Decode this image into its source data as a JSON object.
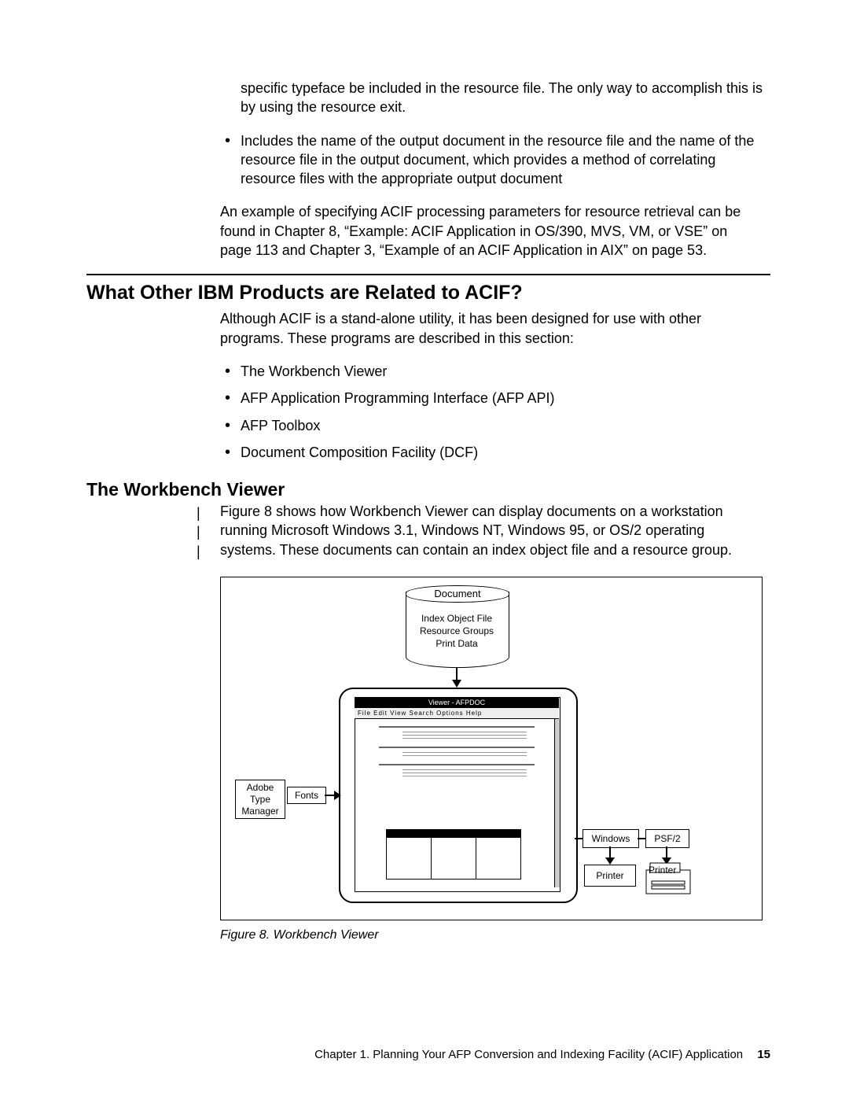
{
  "intro": {
    "p1": "specific typeface be included in the resource file. The only way to accomplish this is by using the resource exit.",
    "b1": "Includes the name of the output document in the resource file and the name of the resource file in the output document, which provides a method of correlating resource files with the appropriate output document",
    "p2": "An example of specifying ACIF processing parameters for resource retrieval can be found in Chapter 8, “Example: ACIF Application in OS/390, MVS, VM, or VSE” on page 113 and Chapter 3, “Example of an ACIF Application in AIX” on page 53."
  },
  "h2": "What Other IBM Products are Related to ACIF?",
  "sec1": {
    "p1": "Although ACIF is a stand-alone utility, it has been designed for use with other programs. These programs are described in this section:",
    "items": [
      "The Workbench Viewer",
      "AFP Application Programming Interface (AFP API)",
      "AFP Toolbox",
      "Document Composition Facility (DCF)"
    ]
  },
  "h3": "The Workbench Viewer",
  "sec2": {
    "p1": "Figure 8 shows how Workbench Viewer can display documents on a workstation running Microsoft Windows 3.1, Windows NT, Windows 95, or OS/2 operating systems. These documents can contain an index object file and a resource group."
  },
  "changebar": "|\n|\n|",
  "fig": {
    "cyl_title": "Document",
    "cyl_l1": "Index Object File",
    "cyl_l2": "Resource Groups",
    "cyl_l3": "Print Data",
    "win_title": "Viewer - AFPDOC",
    "win_menu": "File  Edit  View  Search  Options  Help",
    "atm_l1": "Adobe",
    "atm_l2": "Type",
    "atm_l3": "Manager",
    "fonts": "Fonts",
    "windows": "Windows",
    "psf2": "PSF/2",
    "printerA": "Printer",
    "printerB": "Printer"
  },
  "caption": "Figure 8. Workbench Viewer",
  "footer": {
    "text": "Chapter 1. Planning Your AFP Conversion and Indexing Facility (ACIF) Application",
    "page": "15"
  }
}
